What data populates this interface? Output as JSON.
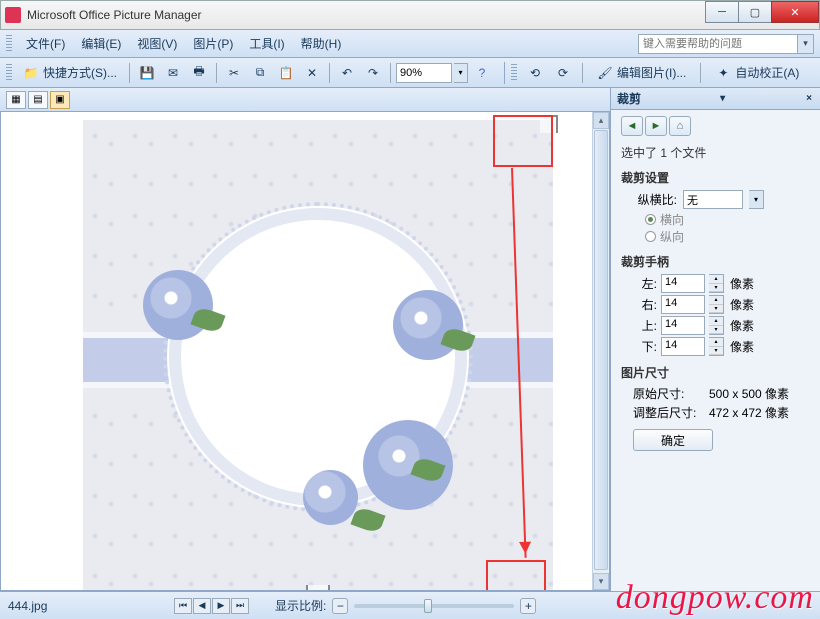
{
  "window": {
    "title": "Microsoft Office Picture Manager"
  },
  "menu": {
    "file": "文件(F)",
    "edit": "编辑(E)",
    "view": "视图(V)",
    "picture": "图片(P)",
    "tools": "工具(I)",
    "help": "帮助(H)",
    "helpbox_placeholder": "键入需要帮助的问题"
  },
  "toolbar": {
    "shortcut": "快捷方式(S)...",
    "zoom_value": "90%",
    "edit_picture": "编辑图片(I)...",
    "auto_correct": "自动校正(A)"
  },
  "taskpane": {
    "title": "裁剪",
    "selected": "选中了 1 个文件",
    "crop_settings": "裁剪设置",
    "aspect_label": "纵横比:",
    "aspect_value": "无",
    "landscape": "横向",
    "portrait": "纵向",
    "handles": "裁剪手柄",
    "left": "左:",
    "right": "右:",
    "top": "上:",
    "bottom": "下:",
    "left_v": "14",
    "right_v": "14",
    "top_v": "14",
    "bottom_v": "14",
    "px": "像素",
    "size": "图片尺寸",
    "orig_label": "原始尺寸:",
    "orig_value": "500 x 500 像素",
    "new_label": "调整后尺寸:",
    "new_value": "472 x 472 像素",
    "ok": "确定"
  },
  "status": {
    "filename": "444.jpg",
    "zoom_label": "显示比例:"
  },
  "watermark": "dongpow.com"
}
